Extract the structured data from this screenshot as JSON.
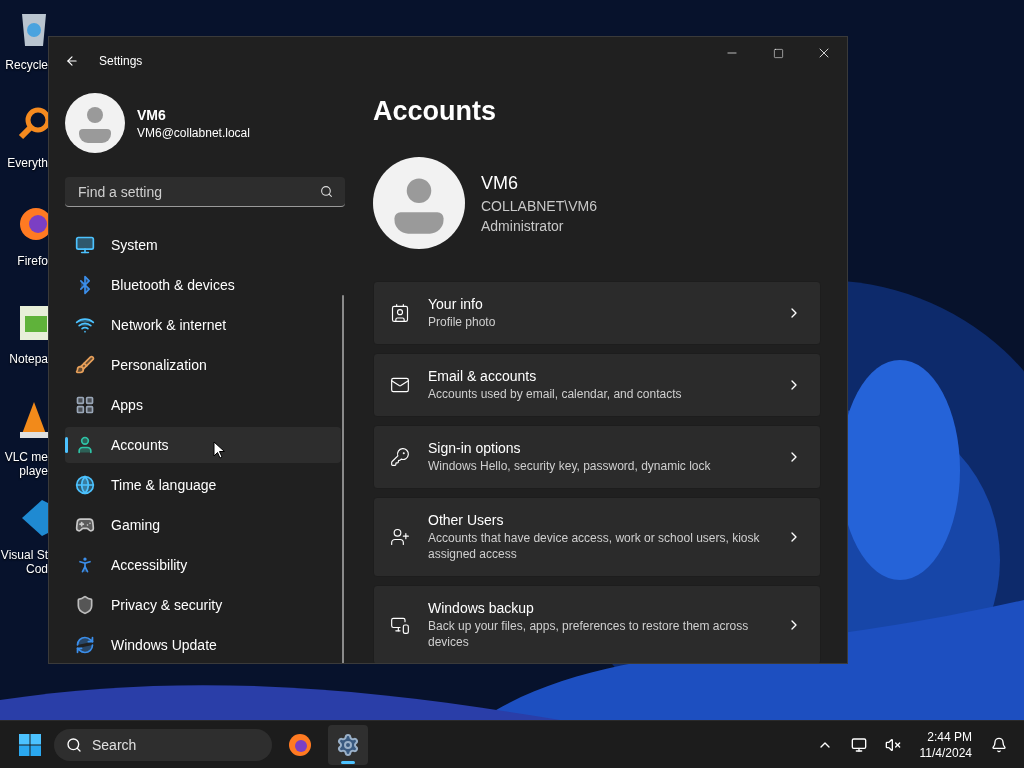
{
  "desktop": {
    "icons": [
      {
        "kind": "recycle",
        "label_lines": [
          "Recycle"
        ]
      },
      {
        "kind": "search",
        "label_lines": [
          "Everyth"
        ]
      },
      {
        "kind": "firefox",
        "label_lines": [
          "Firefo"
        ]
      },
      {
        "kind": "notepad",
        "label_lines": [
          "Notepa"
        ]
      },
      {
        "kind": "vlc",
        "label_lines": [
          "VLC me",
          "playe"
        ]
      },
      {
        "kind": "vscode",
        "label_lines": [
          "Visual St",
          "Cod"
        ]
      }
    ]
  },
  "window": {
    "title": "Settings",
    "user": {
      "name": "VM6",
      "email": "VM6@collabnet.local"
    },
    "search": {
      "placeholder": "Find a setting"
    },
    "nav": [
      {
        "kind": "system",
        "label": "System",
        "selected": false
      },
      {
        "kind": "bluetooth",
        "label": "Bluetooth & devices",
        "selected": false
      },
      {
        "kind": "network",
        "label": "Network & internet",
        "selected": false
      },
      {
        "kind": "personalization",
        "label": "Personalization",
        "selected": false
      },
      {
        "kind": "apps",
        "label": "Apps",
        "selected": false
      },
      {
        "kind": "accounts",
        "label": "Accounts",
        "selected": true
      },
      {
        "kind": "time",
        "label": "Time & language",
        "selected": false
      },
      {
        "kind": "gaming",
        "label": "Gaming",
        "selected": false
      },
      {
        "kind": "accessibility",
        "label": "Accessibility",
        "selected": false
      },
      {
        "kind": "privacy",
        "label": "Privacy & security",
        "selected": false
      },
      {
        "kind": "update",
        "label": "Windows Update",
        "selected": false
      }
    ],
    "page_title": "Accounts",
    "account": {
      "name": "VM6",
      "domain": "COLLABNET\\VM6",
      "role": "Administrator"
    },
    "cards": [
      {
        "kind": "info",
        "title": "Your info",
        "subtitle": "Profile photo"
      },
      {
        "kind": "email",
        "title": "Email & accounts",
        "subtitle": "Accounts used by email, calendar, and contacts"
      },
      {
        "kind": "signin",
        "title": "Sign-in options",
        "subtitle": "Windows Hello, security key, password, dynamic lock"
      },
      {
        "kind": "users",
        "title": "Other Users",
        "subtitle": "Accounts that have device access, work or school users, kiosk assigned access"
      },
      {
        "kind": "backup",
        "title": "Windows backup",
        "subtitle": "Back up your files, apps, preferences to restore them across devices"
      }
    ]
  },
  "taskbar": {
    "search": {
      "placeholder": "Search"
    },
    "apps": [
      {
        "kind": "firefox",
        "active": false
      },
      {
        "kind": "settings",
        "active": true
      }
    ],
    "time": "2:44 PM",
    "date": "11/4/2024"
  }
}
